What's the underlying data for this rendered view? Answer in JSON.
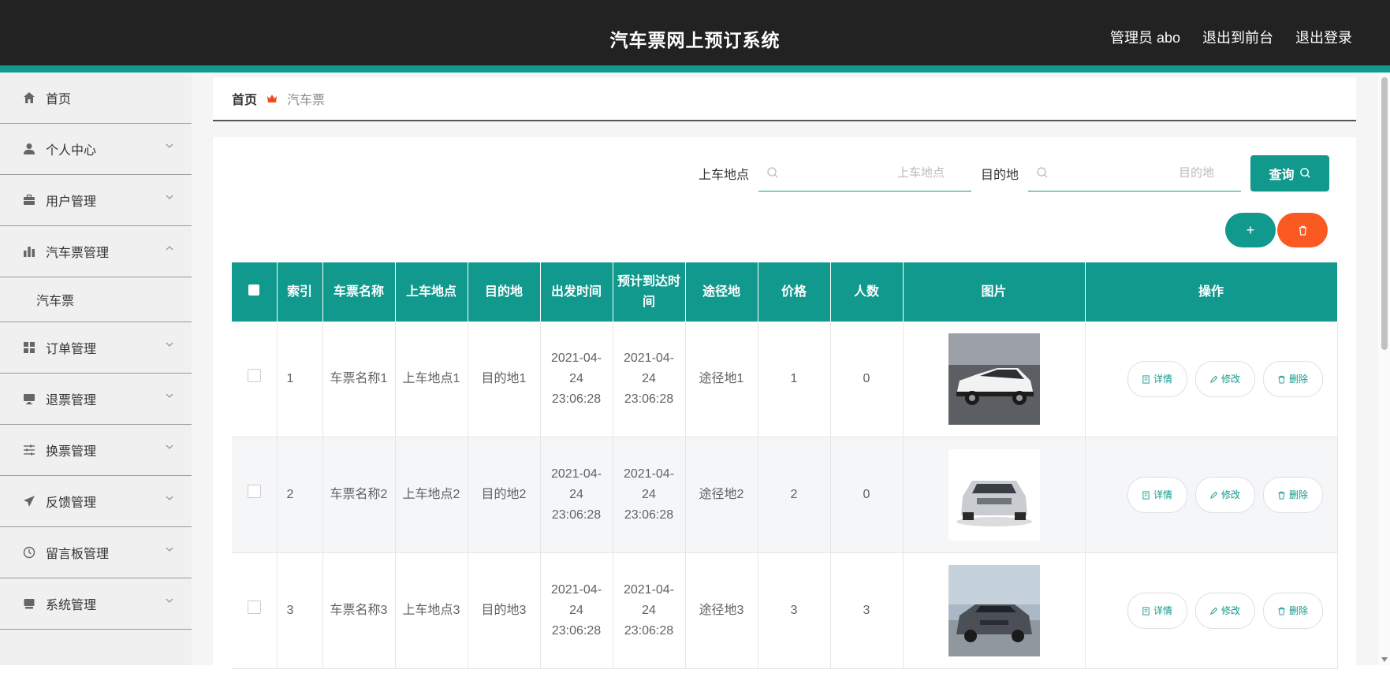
{
  "header": {
    "title": "汽车票网上预订系统",
    "admin": "管理员 abo",
    "to_front": "退出到前台",
    "logout": "退出登录"
  },
  "sidebar": {
    "items": [
      {
        "label": "首页",
        "icon": "home-icon"
      },
      {
        "label": "个人中心",
        "icon": "user-icon"
      },
      {
        "label": "用户管理",
        "icon": "briefcase-icon"
      },
      {
        "label": "汽车票管理",
        "icon": "bar-chart-icon"
      },
      {
        "label": "订单管理",
        "icon": "grid-icon"
      },
      {
        "label": "退票管理",
        "icon": "monitor-icon"
      },
      {
        "label": "换票管理",
        "icon": "sliders-icon"
      },
      {
        "label": "反馈管理",
        "icon": "send-icon"
      },
      {
        "label": "留言板管理",
        "icon": "clock-icon"
      },
      {
        "label": "系统管理",
        "icon": "box-icon"
      }
    ],
    "sub_item": "汽车票"
  },
  "breadcrumb": {
    "home": "首页",
    "current": "汽车票"
  },
  "search": {
    "label1": "上车地点",
    "placeholder1": "上车地点",
    "label2": "目的地",
    "placeholder2": "目的地",
    "button": "查询"
  },
  "table": {
    "headers": [
      "索引",
      "车票名称",
      "上车地点",
      "目的地",
      "出发时间",
      "预计到达时间",
      "途径地",
      "价格",
      "人数",
      "图片",
      "操作"
    ],
    "rows": [
      {
        "index": "1",
        "name": "车票名称1",
        "from": "上车地点1",
        "to": "目的地1",
        "depart": "2021-04-24 23:06:28",
        "arrive": "2021-04-24 23:06:28",
        "via": "途径地1",
        "price": "1",
        "count": "0"
      },
      {
        "index": "2",
        "name": "车票名称2",
        "from": "上车地点2",
        "to": "目的地2",
        "depart": "2021-04-24 23:06:28",
        "arrive": "2021-04-24 23:06:28",
        "via": "途径地2",
        "price": "2",
        "count": "0"
      },
      {
        "index": "3",
        "name": "车票名称3",
        "from": "上车地点3",
        "to": "目的地3",
        "depart": "2021-04-24 23:06:28",
        "arrive": "2021-04-24 23:06:28",
        "via": "途径地3",
        "price": "3",
        "count": "3"
      }
    ],
    "op_detail": "详情",
    "op_edit": "修改",
    "op_delete": "删除"
  },
  "colors": {
    "accent": "#11998e",
    "danger": "#fa5a22",
    "topbar": "#222222"
  }
}
